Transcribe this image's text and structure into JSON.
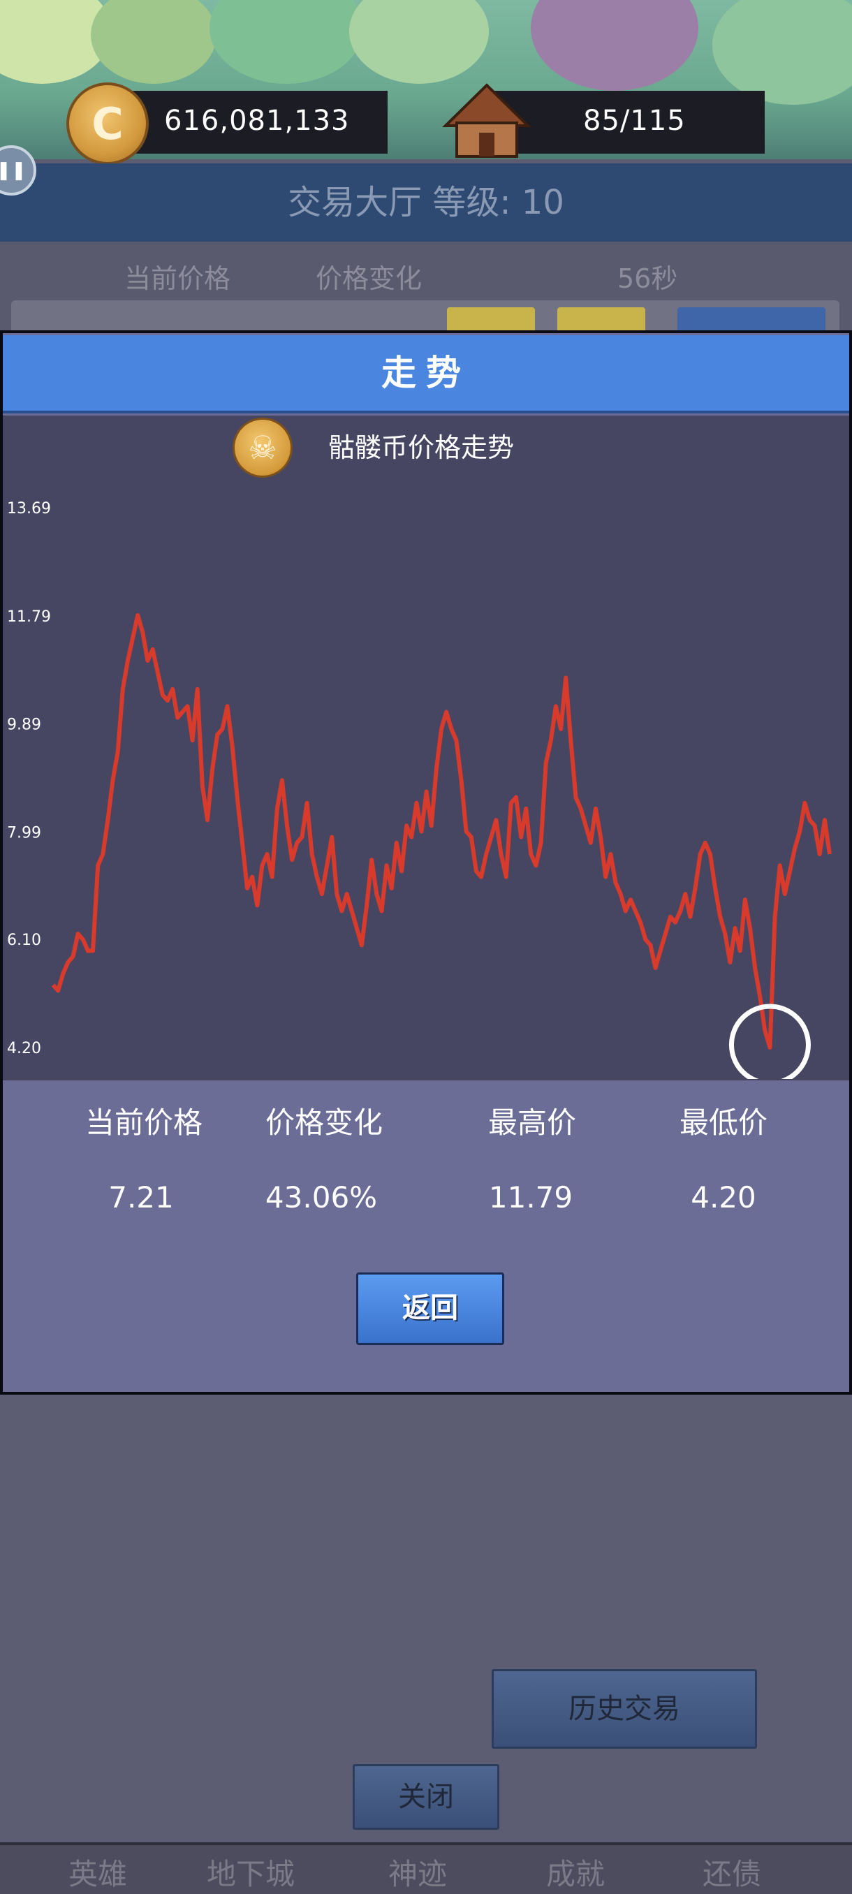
{
  "top_bar": {
    "gold": "616,081,133",
    "coin_symbol": "C",
    "capacity": "85/115"
  },
  "hall": {
    "title": "交易大厅 等级: 10",
    "columns": [
      "当前价格",
      "价格变化",
      "56秒"
    ]
  },
  "trend_dialog": {
    "title": "走势",
    "chart_title": "骷髅币价格走势",
    "coin_icon": "skull-coin-icon",
    "stats": {
      "labels": [
        "当前价格",
        "价格变化",
        "最高价",
        "最低价"
      ],
      "values": [
        "7.21",
        "43.06%",
        "11.79",
        "4.20"
      ]
    },
    "back_label": "返回"
  },
  "chart_data": {
    "type": "line",
    "title": "骷髅币价格走势",
    "ytick_labels": [
      "13.69",
      "11.79",
      "9.89",
      "7.99",
      "6.10",
      "4.20"
    ],
    "ylim": [
      4.2,
      13.69
    ],
    "line_color": "#d83a2c",
    "highlight": {
      "point": "minimum",
      "value": 4.2
    },
    "series": [
      {
        "values": [
          5.3,
          5.2,
          5.5,
          5.7,
          5.8,
          6.2,
          6.1,
          5.9,
          5.9,
          7.4,
          7.6,
          8.2,
          8.9,
          9.4,
          10.5,
          11.0,
          11.4,
          11.8,
          11.5,
          11.0,
          11.2,
          10.8,
          10.4,
          10.3,
          10.5,
          10.0,
          10.1,
          10.2,
          9.6,
          10.5,
          8.8,
          8.2,
          9.1,
          9.7,
          9.8,
          10.2,
          9.5,
          8.6,
          7.8,
          7.0,
          7.2,
          6.7,
          7.4,
          7.6,
          7.2,
          8.4,
          8.9,
          8.1,
          7.5,
          7.8,
          7.9,
          8.5,
          7.6,
          7.2,
          6.9,
          7.4,
          7.9,
          6.9,
          6.6,
          6.9,
          6.6,
          6.3,
          6.0,
          6.7,
          7.5,
          6.9,
          6.6,
          7.4,
          7.0,
          7.8,
          7.3,
          8.1,
          7.9,
          8.5,
          8.0,
          8.7,
          8.1,
          9.1,
          9.8,
          10.1,
          9.8,
          9.6,
          8.9,
          8.0,
          7.9,
          7.3,
          7.2,
          7.6,
          7.9,
          8.2,
          7.6,
          7.2,
          8.5,
          8.6,
          7.9,
          8.4,
          7.6,
          7.4,
          7.8,
          9.2,
          9.6,
          10.2,
          9.8,
          10.7,
          9.6,
          8.6,
          8.4,
          8.1,
          7.8,
          8.4,
          7.9,
          7.2,
          7.6,
          7.1,
          6.9,
          6.6,
          6.8,
          6.6,
          6.4,
          6.1,
          6.0,
          5.6,
          5.9,
          6.2,
          6.5,
          6.4,
          6.6,
          6.9,
          6.5,
          7.0,
          7.6,
          7.8,
          7.6,
          7.0,
          6.5,
          6.2,
          5.7,
          6.3,
          5.9,
          6.8,
          6.3,
          5.6,
          5.1,
          4.5,
          4.2,
          6.5,
          7.4,
          6.9,
          7.3,
          7.7,
          8.0,
          8.5,
          8.2,
          8.1,
          7.6,
          8.2,
          7.6
        ],
        "note": ""
      }
    ]
  },
  "lower": {
    "history_label": "历史交易",
    "close_label": "关闭"
  },
  "bottom_nav": [
    "英雄",
    "地下城",
    "神迹",
    "成就",
    "还债"
  ],
  "colors": {
    "accent": "#4a86e0",
    "chart_bg": "#464663",
    "line": "#d83a2c",
    "dialog_bg": "#6b6d96"
  }
}
